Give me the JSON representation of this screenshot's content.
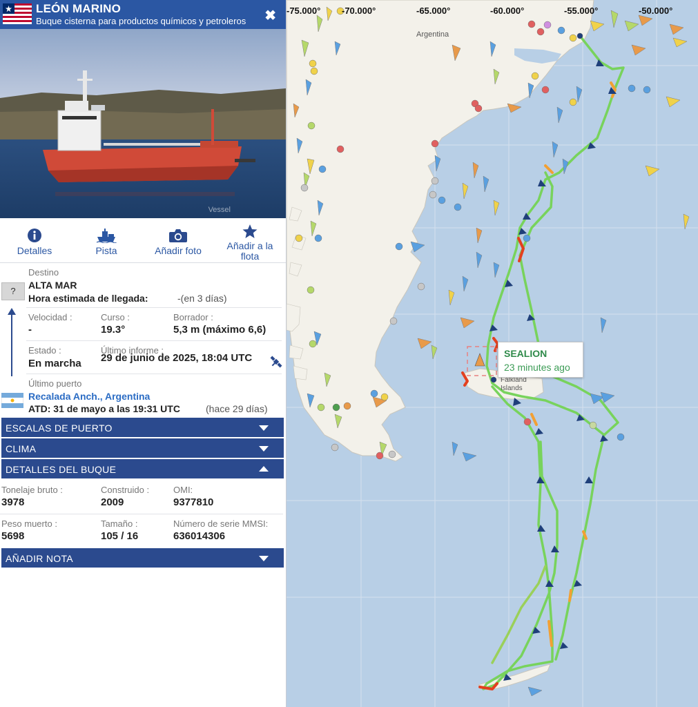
{
  "vessel": {
    "name": "LEÓN MARINO",
    "type": "Buque cisterna para productos químicos y petroleros",
    "photo_watermark": "Vessel",
    "flag_icon": "liberia-flag-icon"
  },
  "tabs": [
    {
      "label": "Detalles",
      "icon": "info-icon"
    },
    {
      "label": "Pista",
      "icon": "ship-track-icon"
    },
    {
      "label": "Añadir foto",
      "icon": "camera-icon"
    },
    {
      "label": "Añadir a la flota",
      "icon": "star-icon"
    }
  ],
  "voyage": {
    "destination_label": "Destino",
    "destination": "ALTA MAR",
    "eta_label": "Hora estimada de llegada:",
    "eta_value": "-(en 3 días)",
    "unknown_port_icon": "?",
    "speed_label": "Velocidad :",
    "speed_value": "-",
    "course_label": "Curso :",
    "course_value": "19.3°",
    "draught_label": "Borrador :",
    "draught_value": "5,3 m (máximo 6,6)",
    "status_label": "Estado :",
    "status_value": "En marcha",
    "last_report_label": "Último informe :",
    "last_report_value": "29 de junio de 2025, 18:04 UTC",
    "last_port_label": "Último puerto",
    "last_port_name": "Recalada Anch., Argentina",
    "atd_label": "ATD: 31 de mayo a las 19:31 UTC",
    "atd_ago": "(hace 29 días)"
  },
  "accordions": {
    "port_calls": "ESCALAS DE PUERTO",
    "weather": "CLIMA",
    "vessel_details": "DETALLES DEL BUQUE",
    "add_note": "AÑADIR NOTA"
  },
  "vessel_details": {
    "gross_tonnage_label": "Tonelaje bruto :",
    "gross_tonnage": "3978",
    "built_label": "Construido :",
    "built": "2009",
    "imo_label": "OMI:",
    "imo": "9377810",
    "deadweight_label": "Peso muerto :",
    "deadweight": "5698",
    "size_label": "Tamaño :",
    "size": "105 / 16",
    "mmsi_label": "Número de serie MMSI:",
    "mmsi": "636014306"
  },
  "map": {
    "longitudes": [
      "-75.000°",
      "-70.000°",
      "-65.000°",
      "-60.000°",
      "-55.000°",
      "-50.000°"
    ],
    "country_label": "Argentina",
    "island_label": "Falkland Islands",
    "tooltip": {
      "name": "SEALION",
      "ago": "23 minutes ago"
    },
    "colors": {
      "sea": "#b8cfe6",
      "land": "#f3f1ea",
      "track": "#7ed957",
      "header": "#2b57a3"
    }
  }
}
